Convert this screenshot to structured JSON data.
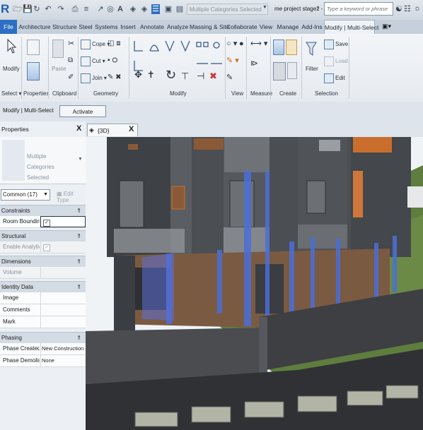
{
  "app": {
    "logo": "R"
  },
  "quick_access": {
    "icons": [
      "open-icon",
      "save-icon",
      "sync-icon",
      "undo-icon",
      "redo-icon",
      "print-icon",
      "measure-icon",
      "dimension-icon",
      "text-icon",
      "3d-view-icon",
      "section-icon",
      "thin-lines-icon",
      "close-windows-icon",
      "switch-windows-icon"
    ],
    "selection_dropdown": "Multiple Categories Selected",
    "document_title": "me project stage2 -...",
    "search_placeholder": "Type a keyword or phrase"
  },
  "tabs": [
    "File",
    "Architecture",
    "Structure",
    "Steel",
    "Systems",
    "Insert",
    "Annotate",
    "Analyze",
    "Massing & Site",
    "Collaborate",
    "View",
    "Manage",
    "Add-Ins",
    "Modify | Multi-Select"
  ],
  "active_tab": "Modify | Multi-Select",
  "ribbon": {
    "panels": [
      "Select",
      "Properties",
      "Clipboard",
      "Geometry",
      "Modify",
      "View",
      "Measure",
      "Create",
      "Selection"
    ],
    "select_button": "Modify",
    "clipboard": {
      "paste": "Paste"
    },
    "geometry": {
      "cope": "Cope",
      "cut": "Cut",
      "join": "Join"
    },
    "filter": "Filter",
    "selection": {
      "save": "Save",
      "load": "Load",
      "edit": "Edit"
    }
  },
  "context_bar": {
    "label": "Modify | Multi-Select",
    "button": "Activate Dimensions"
  },
  "properties": {
    "title": "Properties",
    "type_name": "Multiple Categories Selected",
    "filter_value": "Common (17)",
    "edit_type": "Edit Type",
    "groups": [
      {
        "name": "Constraints",
        "rows": [
          {
            "name": "Room Bounding",
            "value": "checked"
          }
        ]
      },
      {
        "name": "Structural",
        "rows": [
          {
            "name": "Enable Analytic...",
            "value": "checked-disabled"
          }
        ]
      },
      {
        "name": "Dimensions",
        "rows": [
          {
            "name": "Volume",
            "value": ""
          }
        ]
      },
      {
        "name": "Identity Data",
        "rows": [
          {
            "name": "Image",
            "value": ""
          },
          {
            "name": "Comments",
            "value": ""
          },
          {
            "name": "Mark",
            "value": ""
          }
        ]
      },
      {
        "name": "Phasing",
        "rows": [
          {
            "name": "Phase Created",
            "value": "New Construction"
          },
          {
            "name": "Phase Demolish...",
            "value": "None"
          }
        ]
      }
    ]
  },
  "view": {
    "tab_label": "{3D}"
  },
  "colors": {
    "file_tab": "#2d6fc2",
    "selected_blue": "#4a6fd8",
    "facade": "#4b4e52",
    "grass": "#5f7d3e",
    "floor": "#7b5a42"
  }
}
